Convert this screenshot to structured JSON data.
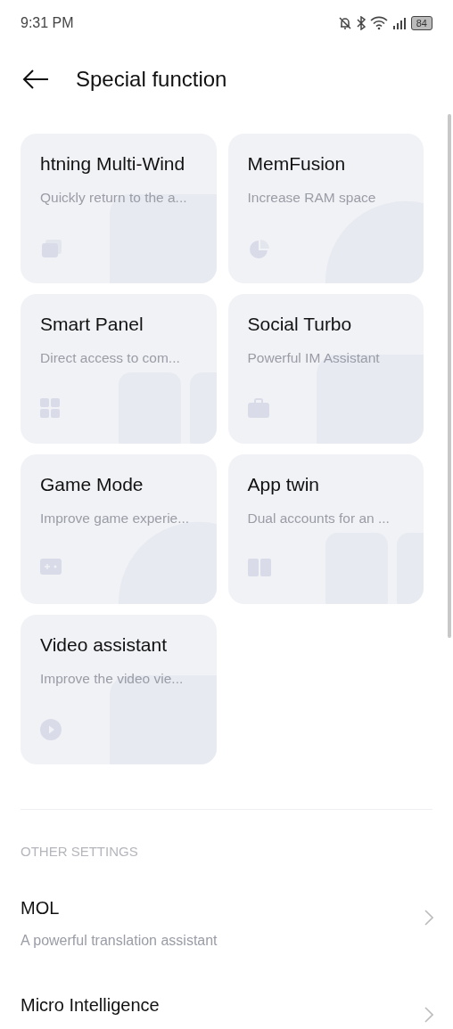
{
  "status_bar": {
    "time": "9:31 PM",
    "battery": "84"
  },
  "header": {
    "title": "Special function"
  },
  "cards": [
    {
      "title": "htning Multi-Wind",
      "subtitle": "Quickly return to the a..."
    },
    {
      "title": "MemFusion",
      "subtitle": "Increase RAM space"
    },
    {
      "title": "Smart Panel",
      "subtitle": "Direct access to com..."
    },
    {
      "title": "Social Turbo",
      "subtitle": "Powerful IM Assistant"
    },
    {
      "title": "Game Mode",
      "subtitle": "Improve game experie..."
    },
    {
      "title": "App twin",
      "subtitle": "Dual accounts for an ..."
    },
    {
      "title": "Video assistant",
      "subtitle": "Improve the video vie..."
    }
  ],
  "other_settings": {
    "heading": "OTHER SETTINGS",
    "items": [
      {
        "title": "MOL",
        "subtitle": "A powerful translation assistant"
      },
      {
        "title": "Micro Intelligence"
      }
    ]
  }
}
